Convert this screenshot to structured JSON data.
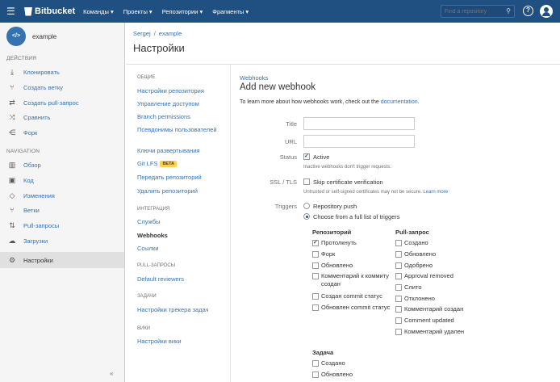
{
  "topbar": {
    "logo": "Bitbucket",
    "nav": [
      "Команды ▾",
      "Проекты ▾",
      "Репозитории ▾",
      "Фрагменты ▾"
    ],
    "search_placeholder": "Find a repository",
    "help": "?"
  },
  "sidebar": {
    "repo_avatar": "</>",
    "repo_name": "example",
    "actions_title": "ДЕЙСТВИЯ",
    "actions": [
      {
        "icon": "download-icon",
        "glyph": "⤓",
        "label": "Клонировать"
      },
      {
        "icon": "branch-icon",
        "glyph": "⑂",
        "label": "Создать ветку"
      },
      {
        "icon": "pull-request-icon",
        "glyph": "⇄",
        "label": "Создать pull-запрос"
      },
      {
        "icon": "compare-icon",
        "glyph": "⤨",
        "label": "Сравнить"
      },
      {
        "icon": "fork-icon",
        "glyph": "⋲",
        "label": "Форк"
      }
    ],
    "nav_title": "NAVIGATION",
    "nav": [
      {
        "icon": "overview-icon",
        "glyph": "▥",
        "label": "Обзор"
      },
      {
        "icon": "code-icon",
        "glyph": "▣",
        "label": "Код"
      },
      {
        "icon": "commits-icon",
        "glyph": "◇",
        "label": "Изменения"
      },
      {
        "icon": "branches-icon",
        "glyph": "⑂",
        "label": "Ветки"
      },
      {
        "icon": "pull-requests-icon",
        "glyph": "⇅",
        "label": "Pull-запросы"
      },
      {
        "icon": "downloads-icon",
        "glyph": "☁",
        "label": "Загрузки"
      }
    ],
    "settings": {
      "icon": "gear-icon",
      "glyph": "⚙",
      "label": "Настройки"
    },
    "collapse": "«"
  },
  "header": {
    "breadcrumb_user": "Sergej",
    "breadcrumb_sep": "/",
    "breadcrumb_repo": "example",
    "title": "Настройки"
  },
  "settings_nav": {
    "general_title": "ОБЩИЕ",
    "general": [
      "Настройки репозитория",
      "Управление доступом",
      "Branch permissions",
      "Псевдонимы пользователей",
      "Ключи развертывания",
      "Git LFS",
      "Передать репозиторий",
      "Удалить репозиторий"
    ],
    "beta": "BETA",
    "integration_title": "ИНТЕГРАЦИЯ",
    "integration": [
      "Службы",
      "Webhooks",
      "Ссылки"
    ],
    "pr_title": "PULL-ЗАПРОСЫ",
    "pr": [
      "Default reviewers"
    ],
    "issues_title": "ЗАДАЧИ",
    "issues": [
      "Настройки трекера задач"
    ],
    "wiki_title": "ВИКИ",
    "wiki": [
      "Настройки вики"
    ]
  },
  "form": {
    "breadcrumb": "Webhooks",
    "title": "Add new webhook",
    "intro_text": "To learn more about how webhooks work, check out the ",
    "intro_link": "documentation",
    "intro_end": ".",
    "title_label": "Title",
    "title_value": "",
    "url_label": "URL",
    "url_value": "",
    "status_label": "Status",
    "status_option": "Active",
    "status_hint": "Inactive webhooks don't trigger requests.",
    "ssl_label": "SSL / TLS",
    "ssl_option": "Skip certificate verification",
    "ssl_hint": "Untrusted or self-signed certificates may not be secure.",
    "ssl_hint_link": "Learn more",
    "triggers_label": "Triggers",
    "trigger_push": "Repository push",
    "trigger_choose": "Choose from a full list of triggers",
    "repo_group": "Репозиторий",
    "repo_events": [
      {
        "label": "Протолкнуть",
        "checked": true
      },
      {
        "label": "Форк",
        "checked": false
      },
      {
        "label": "Обновлено",
        "checked": false
      },
      {
        "label": "Комментарий к коммиту создан",
        "checked": false
      },
      {
        "label": "Создан commit статус",
        "checked": false
      },
      {
        "label": "Обновлен commit статус",
        "checked": false
      }
    ],
    "pr_group": "Pull-запрос",
    "pr_events": [
      {
        "label": "Создано",
        "checked": false
      },
      {
        "label": "Обновлено",
        "checked": false
      },
      {
        "label": "Одобрено",
        "checked": false
      },
      {
        "label": "Approval removed",
        "checked": false
      },
      {
        "label": "Слито",
        "checked": false
      },
      {
        "label": "Отклонено",
        "checked": false
      },
      {
        "label": "Комментарий создан",
        "checked": false
      },
      {
        "label": "Comment updated",
        "checked": false
      },
      {
        "label": "Комментарий удален",
        "checked": false
      }
    ],
    "issue_group": "Задача",
    "issue_events": [
      {
        "label": "Создано",
        "checked": false
      },
      {
        "label": "Обновлено",
        "checked": false
      }
    ]
  }
}
